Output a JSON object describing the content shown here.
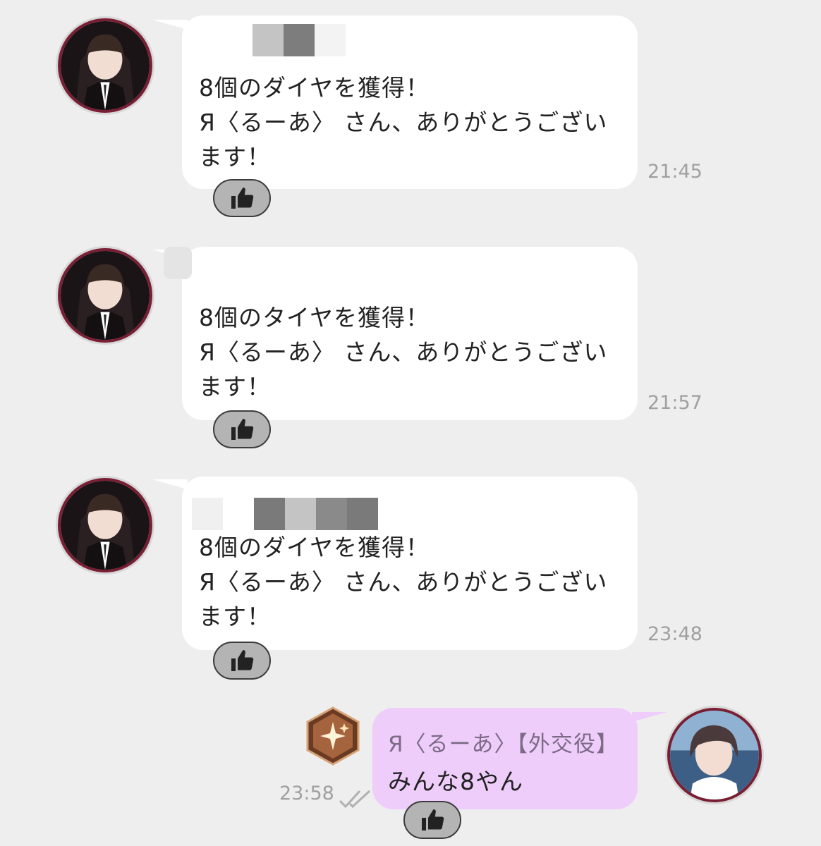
{
  "messages": [
    {
      "name_blur_colors": [
        "#ffffff",
        "#c4c4c4",
        "#7d7d7d",
        "#f3f3f3"
      ],
      "text": "8個のダイヤを獲得！\nЯ〈るーあ〉 さん、ありがとうござい\nます！",
      "time": "21:45"
    },
    {
      "name_blur_colors": [
        "#e4e4e4"
      ],
      "text": "8個のタイヤを獲得！\nЯ〈るーあ〉 さん、ありがとうござい\nます！",
      "time": "21:57"
    },
    {
      "name_blur_colors": [
        "#f0f0f0",
        "#ffffff",
        "#7a7a7a",
        "#c4c4c4",
        "#8a8a8a",
        "#7a7a7a"
      ],
      "text": "8個のダイヤを獲得！\nЯ〈るーあ〉 さん、ありがとうござい\nます！",
      "time": "23:48"
    }
  ],
  "my_message": {
    "sender": "Я〈るーあ〉【外交役】",
    "text": "みんな8やん",
    "time": "23:58"
  },
  "icons": {
    "like": "thumbs-up-icon",
    "badge": "star-hexagon-badge-icon",
    "read": "double-check-icon"
  },
  "colors": {
    "background": "#eeeeee",
    "bubble": "#ffffff",
    "my_bubble": "#efcdfb",
    "avatar_ring": "#7a1f33",
    "timestamp": "#a0a0a0"
  }
}
